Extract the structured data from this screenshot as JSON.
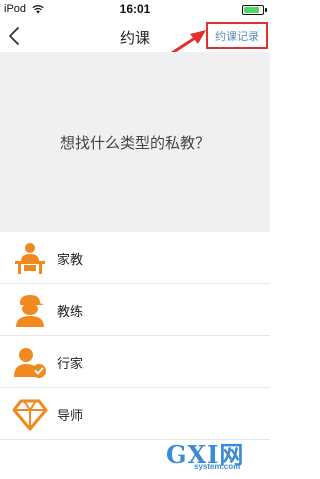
{
  "status_bar": {
    "carrier": "iPod",
    "time": "16:01",
    "battery_level": 0.85,
    "battery_color": "#4cd964"
  },
  "nav": {
    "title": "约课",
    "record_button_label": "约课记录",
    "back_icon": "chevron-left-icon"
  },
  "annotation": {
    "arrow_color": "#e03030",
    "highlight_color": "#e03030"
  },
  "hero": {
    "question": "想找什么类型的私教？"
  },
  "categories": [
    {
      "label": "家教",
      "icon": "tutor-at-desk-icon",
      "color": "#f08a1e"
    },
    {
      "label": "教练",
      "icon": "coach-cap-icon",
      "color": "#f08a1e"
    },
    {
      "label": "行家",
      "icon": "expert-check-icon",
      "color": "#f08a1e"
    },
    {
      "label": "导师",
      "icon": "diamond-icon",
      "color": "#f08a1e"
    }
  ],
  "watermark": {
    "brand": "GXI网",
    "domain": "system.com",
    "color": "#3c8bd6"
  }
}
